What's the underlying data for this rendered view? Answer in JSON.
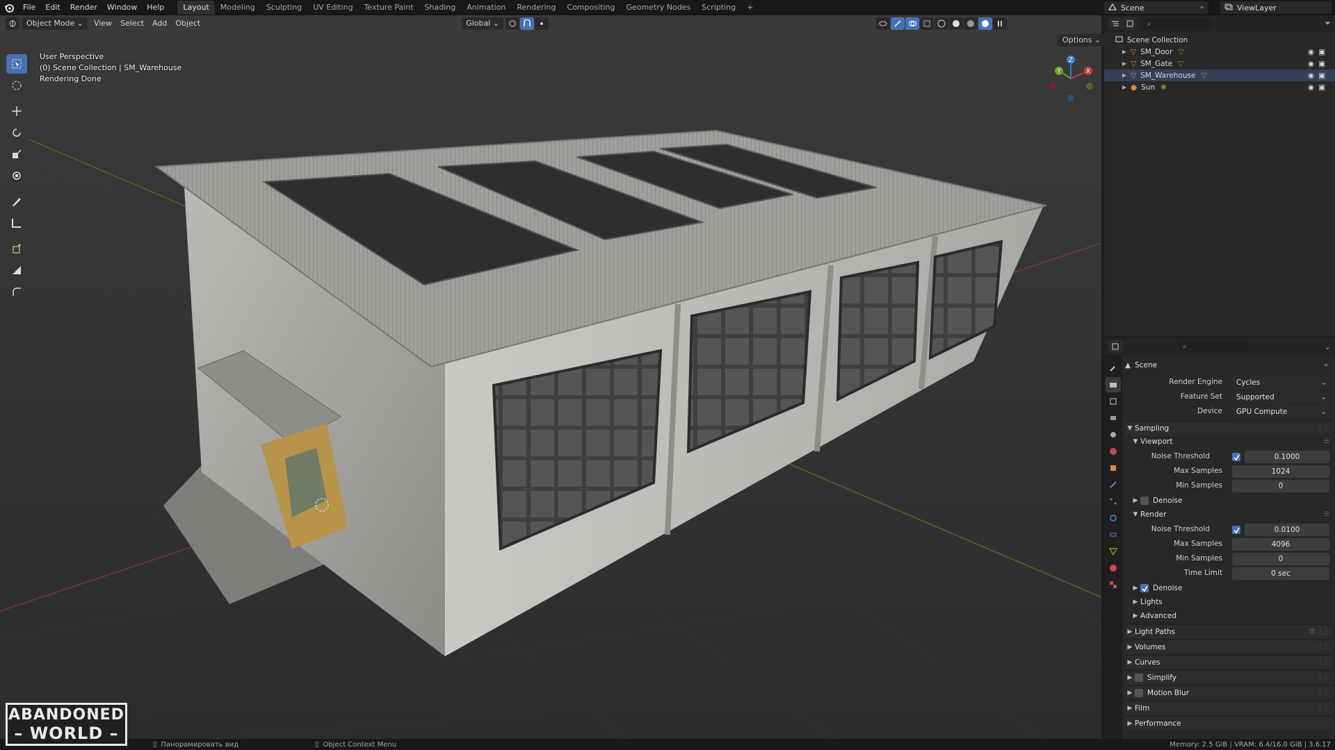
{
  "menu": {
    "file": "File",
    "edit": "Edit",
    "render": "Render",
    "window": "Window",
    "help": "Help"
  },
  "workspaces": [
    "Layout",
    "Modeling",
    "Sculpting",
    "UV Editing",
    "Texture Paint",
    "Shading",
    "Animation",
    "Rendering",
    "Compositing",
    "Geometry Nodes",
    "Scripting"
  ],
  "active_workspace": "Layout",
  "add_tab": "+",
  "scene": {
    "name": "Scene"
  },
  "view_layer": {
    "name": "ViewLayer"
  },
  "viewport_header": {
    "mode": "Object Mode",
    "view": "View",
    "select": "Select",
    "add": "Add",
    "object": "Object",
    "orientation": "Global",
    "options": "Options"
  },
  "viewport_info": {
    "line1": "User Perspective",
    "line2": "(0) Scene Collection | SM_Warehouse",
    "line3": "Rendering Done"
  },
  "gizmo": {
    "x": "X",
    "y": "Y",
    "z": "Z"
  },
  "outliner": {
    "root": "Scene Collection",
    "items": [
      {
        "name": "SM_Door",
        "type": "mesh"
      },
      {
        "name": "SM_Gate",
        "type": "mesh"
      },
      {
        "name": "SM_Warehouse",
        "type": "mesh"
      },
      {
        "name": "Sun",
        "type": "light"
      }
    ]
  },
  "properties": {
    "context": "Scene",
    "render_engine": {
      "label": "Render Engine",
      "value": "Cycles"
    },
    "feature_set": {
      "label": "Feature Set",
      "value": "Supported"
    },
    "device": {
      "label": "Device",
      "value": "GPU Compute"
    },
    "sampling": {
      "title": "Sampling",
      "viewport": {
        "title": "Viewport",
        "noise_threshold_label": "Noise Threshold",
        "noise_threshold": "0.1000",
        "max_samples_label": "Max Samples",
        "max_samples": "1024",
        "min_samples_label": "Min Samples",
        "min_samples": "0"
      },
      "viewport_denoise": "Denoise",
      "render": {
        "title": "Render",
        "noise_threshold_label": "Noise Threshold",
        "noise_threshold": "0.0100",
        "max_samples_label": "Max Samples",
        "max_samples": "4096",
        "min_samples_label": "Min Samples",
        "min_samples": "0",
        "time_limit_label": "Time Limit",
        "time_limit": "0 sec"
      },
      "render_denoise": "Denoise",
      "lights": "Lights",
      "advanced": "Advanced"
    },
    "panels": [
      "Light Paths",
      "Volumes",
      "Curves",
      "Simplify",
      "Motion Blur",
      "Film",
      "Performance"
    ]
  },
  "statusbar": {
    "pan": "Панорамировать вид",
    "context_menu": "Object Context Menu",
    "memory": "Memory: 2.5 GiB | VRAM: 6.4/16.0 GiB | 3.6.17"
  },
  "logo": {
    "line1": "ABANDONED",
    "line2": "WORLD"
  },
  "colors": {
    "accent": "#4772b3",
    "x_axis": "#c23b45",
    "y_axis": "#6ea12e",
    "z_axis": "#3a7cd5"
  }
}
